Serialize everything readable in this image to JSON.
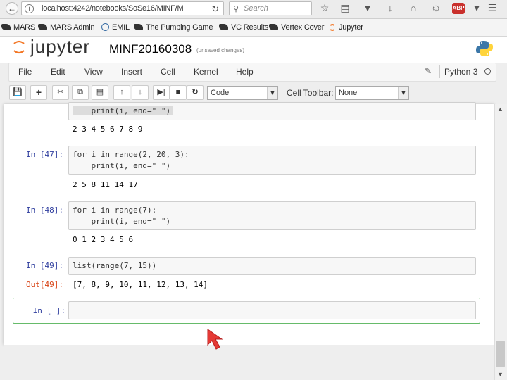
{
  "browser": {
    "url": "localhost:4242/notebooks/SoSe16/MINF/M",
    "search_placeholder": "Search",
    "abp_label": "ABP"
  },
  "bookmarks": [
    {
      "label": "MARS"
    },
    {
      "label": "MARS Admin"
    },
    {
      "label": "EMIL"
    },
    {
      "label": "The Pumping Game"
    },
    {
      "label": "VC Results"
    },
    {
      "label": "Vertex Cover"
    },
    {
      "label": "Jupyter"
    }
  ],
  "jupyter": {
    "logo_text": "jupyter",
    "notebook_name": "MINF20160308",
    "save_status": "(unsaved changes)",
    "kernel": "Python 3",
    "menu": [
      "File",
      "Edit",
      "View",
      "Insert",
      "Cell",
      "Kernel",
      "Help"
    ],
    "cell_type": "Code",
    "cell_toolbar_label": "Cell Toolbar:",
    "cell_toolbar_value": "None"
  },
  "cells": {
    "c0": {
      "code_line": "    print(i, end=\" \")",
      "output": "2 3 4 5 6 7 8 9"
    },
    "c47": {
      "prompt": "In [47]:",
      "line1": "for i in range(2, 20, 3):",
      "line2": "    print(i, end=\" \")",
      "output": "2 5 8 11 14 17"
    },
    "c48": {
      "prompt": "In [48]:",
      "line1": "for i in range(7):",
      "line2": "    print(i, end=\" \")",
      "output": "0 1 2 3 4 5 6"
    },
    "c49": {
      "prompt": "In [49]:",
      "line1": "list(range(7, 15))",
      "out_prompt": "Out[49]:",
      "output": "[7, 8, 9, 10, 11, 12, 13, 14]"
    },
    "new": {
      "prompt": "In [ ]:"
    }
  },
  "colors": {
    "prompt_in": "#303f9f",
    "prompt_out": "#d84315",
    "selected_border": "#66bb6a",
    "keyword": "#008000",
    "string": "#ba2121",
    "cursor": "#e53935"
  }
}
